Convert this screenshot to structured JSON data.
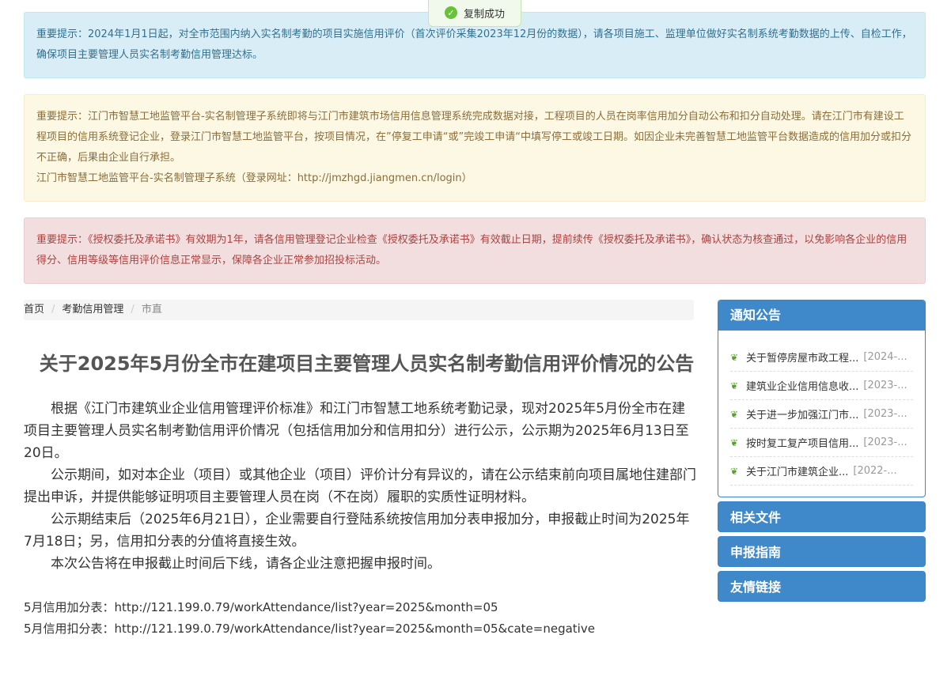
{
  "toast": {
    "text": "复制成功",
    "icon": "check-circle-icon",
    "color": "#67c23a"
  },
  "alerts": {
    "info": "重要提示：2024年1月1日起，对全市范围内纳入实名制考勤的项目实施信用评价（首次评价采集2023年12月份的数据），请各项目施工、监理单位做好实名制系统考勤数据的上传、自检工作，确保项目主要管理人员实名制考勤信用管理达标。",
    "warning_1": "重要提示：江门市智慧工地监管平台-实名制管理子系统即将与江门市建筑市场信用信息管理系统完成数据对接，工程项目的人员在岗率信用加分自动公布和扣分自动处理。请在江门市有建设工程项目的信用系统登记企业，登录江门市智慧工地监管平台，按项目情况，在”停复工申请“或”完竣工申请“中填写停工或竣工日期。如因企业未完善智慧工地监管平台数据造成的信用加分或扣分不正确，后果由企业自行承担。",
    "warning_2": "江门市智慧工地监管平台-实名制管理子系统（登录网址：http://jmzhgd.jiangmen.cn/login）",
    "danger": "重要提示：《授权委托及承诺书》有效期为1年，请各信用管理登记企业检查《授权委托及承诺书》有效截止日期，提前续传《授权委托及承诺书》，确认状态为核查通过，以免影响各企业的信用得分、信用等级等信用评价信息正常显示，保障各企业正常参加招投标活动。"
  },
  "breadcrumb": {
    "home": "首页",
    "section": "考勤信用管理",
    "current": "市直",
    "separator": "/"
  },
  "article": {
    "title": "关于2025年5月份全市在建项目主要管理人员实名制考勤信用评价情况的公告",
    "paragraphs": [
      "根据《江门市建筑业企业信用管理评价标准》和江门市智慧工地系统考勤记录，现对2025年5月份全市在建项目主要管理人员实名制考勤信用评价情况（包括信用加分和信用扣分）进行公示，公示期为2025年6月13日至20日。",
      "公示期间，如对本企业（项目）或其他企业（项目）评价计分有异议的，请在公示结束前向项目属地住建部门提出申诉，并提供能够证明项目主要管理人员在岗（不在岗）履职的实质性证明材料。",
      "公示期结束后（2025年6月21日），企业需要自行登陆系统按信用加分表申报加分，申报截止时间为2025年7月18日；另，信用扣分表的分值将直接生效。",
      "本次公告将在申报截止时间后下线，请各企业注意把握申报时间。"
    ],
    "link_1": "5月信用加分表：http://121.199.0.79/workAttendance/list?year=2025&month=05",
    "link_2": "5月信用扣分表：http://121.199.0.79/workAttendance/list?year=2025&month=05&cate=negative"
  },
  "sidebar": {
    "notices_title": "通知公告",
    "notices": [
      {
        "title": "关于暂停房屋市政工程...",
        "date": "[2024-..."
      },
      {
        "title": "建筑业企业信用信息收...",
        "date": "[2023-..."
      },
      {
        "title": "关于进一步加强江门市...",
        "date": "[2023-..."
      },
      {
        "title": "按时复工复产项目信用...",
        "date": "[2023-..."
      },
      {
        "title": "关于江门市建筑企业...",
        "date": "[2022-..."
      }
    ],
    "files_title": "相关文件",
    "guide_title": "申报指南",
    "links_title": "友情链接",
    "accent": "#3f89cb"
  }
}
